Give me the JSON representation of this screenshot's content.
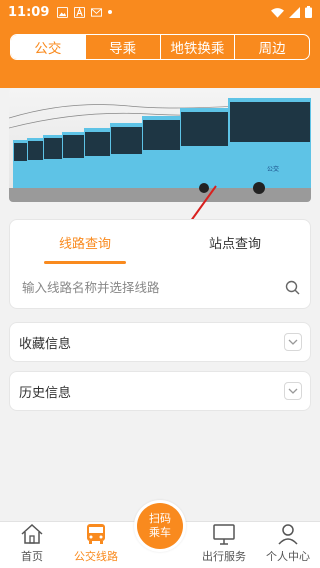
{
  "status_bar": {
    "time": "11:09"
  },
  "top_tabs": [
    {
      "label": "公交",
      "active": true
    },
    {
      "label": "导乘",
      "active": false
    },
    {
      "label": "地铁换乘",
      "active": false
    },
    {
      "label": "周边",
      "active": false
    }
  ],
  "banner": {
    "bus_logo_text": "公交"
  },
  "route_search": {
    "tabs": [
      {
        "label": "线路查询",
        "active": true
      },
      {
        "label": "站点查询",
        "active": false
      }
    ],
    "placeholder": "输入线路名称并选择线路",
    "value": ""
  },
  "favorites": {
    "label": "收藏信息"
  },
  "history": {
    "label": "历史信息"
  },
  "bottom_nav": {
    "home": "首页",
    "bus_routes": "公交线路",
    "scan": "扫码乘车",
    "travel_services": "出行服务",
    "profile": "个人中心"
  },
  "colors": {
    "accent": "#f98a1e",
    "bus_body": "#5ec3e6",
    "annotation_arrow": "#d9201e"
  }
}
